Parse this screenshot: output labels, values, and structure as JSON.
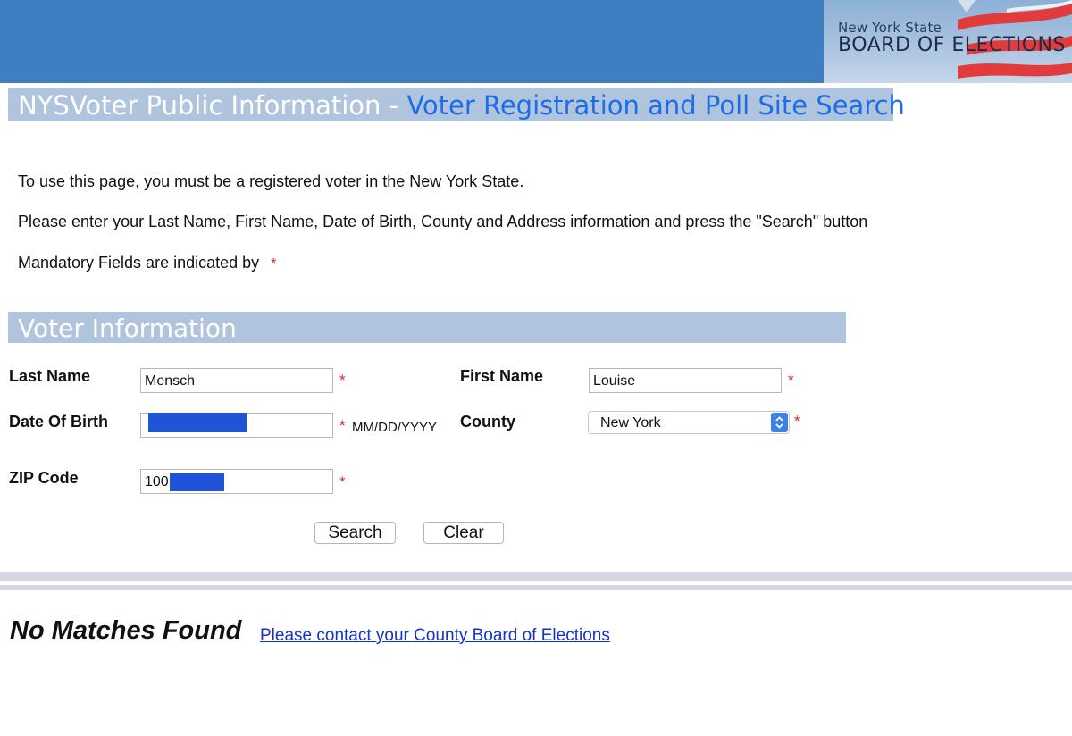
{
  "header": {
    "logo_line1": "New York State",
    "logo_line2": "BOARD OF ELECTIONS"
  },
  "title": {
    "prefix": "NYSVoter Public Information - ",
    "suffix": "Voter Registration and Poll Site Search"
  },
  "instructions": {
    "line1": "To use this page, you must be a registered voter in the New York State.",
    "line2": "Please enter your Last Name, First Name, Date of Birth, County and Address information and press the \"Search\" button",
    "line3": "Mandatory Fields are indicated by",
    "mandatory_marker": "*"
  },
  "section": {
    "title": "Voter Information"
  },
  "form": {
    "required_marker": "*",
    "last_name": {
      "label": "Last Name",
      "value": "Mensch"
    },
    "first_name": {
      "label": "First Name",
      "value": "Louise"
    },
    "dob": {
      "label": "Date Of Birth",
      "value": "",
      "format_hint": "MM/DD/YYYY",
      "redacted": true
    },
    "county": {
      "label": "County",
      "value": "New York"
    },
    "zip": {
      "label": "ZIP Code",
      "value": "100",
      "redacted_suffix": true
    }
  },
  "buttons": {
    "search": "Search",
    "clear": "Clear"
  },
  "result": {
    "message": "No Matches Found",
    "contact_link": "Please contact your County Board of Elections"
  },
  "colors": {
    "banner": "#3d7fc1",
    "title_bar": "#b1c4dd",
    "title_link": "#1a6ee8",
    "required": "#e02020",
    "redaction": "#1f54d6",
    "link": "#1232c8"
  }
}
